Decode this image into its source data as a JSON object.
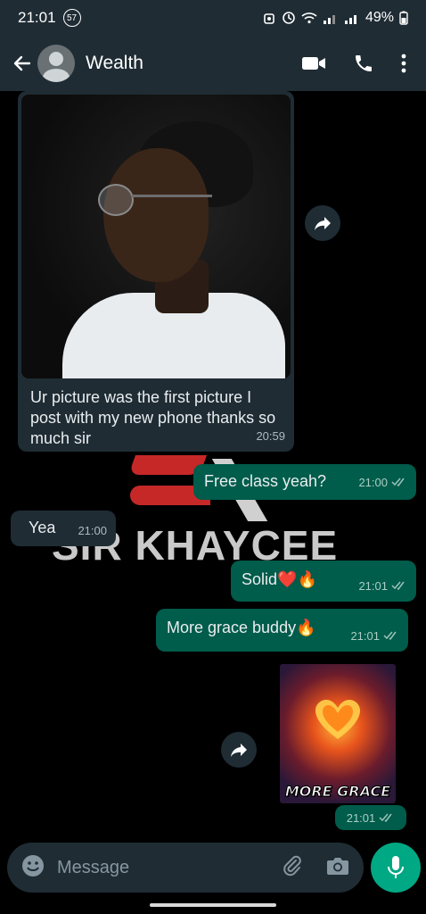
{
  "status_bar": {
    "time": "21:01",
    "notification_count": "57",
    "battery": "49%"
  },
  "header": {
    "contact_name": "Wealth",
    "icons": [
      "back-arrow-icon",
      "avatar",
      "video-call-icon",
      "phone-icon",
      "more-options-icon"
    ]
  },
  "watermark": {
    "text": "SIR KHAYCEE"
  },
  "messages": [
    {
      "direction": "incoming",
      "type": "image",
      "caption": "Ur picture was the first picture I post with my new phone thanks so much sir",
      "time": "20:59"
    },
    {
      "direction": "outgoing",
      "text": "Free class yeah?",
      "time": "21:00",
      "status": "read"
    },
    {
      "direction": "incoming",
      "text": "Yea",
      "time": "21:00"
    },
    {
      "direction": "outgoing",
      "text": "Solid❤️🔥",
      "time": "21:01",
      "status": "read"
    },
    {
      "direction": "outgoing",
      "text": "More grace buddy🔥",
      "time": "21:01",
      "status": "read"
    },
    {
      "direction": "outgoing",
      "type": "sticker",
      "sticker_text": "MORE GRACE",
      "time": "21:01",
      "status": "read"
    }
  ],
  "composer": {
    "placeholder": "Message"
  },
  "colors": {
    "header_bg": "#1f2c34",
    "incoming_bubble": "#1f2c34",
    "outgoing_bubble": "#005c4b",
    "mic_button": "#00a884",
    "chat_bg": "#000000"
  }
}
